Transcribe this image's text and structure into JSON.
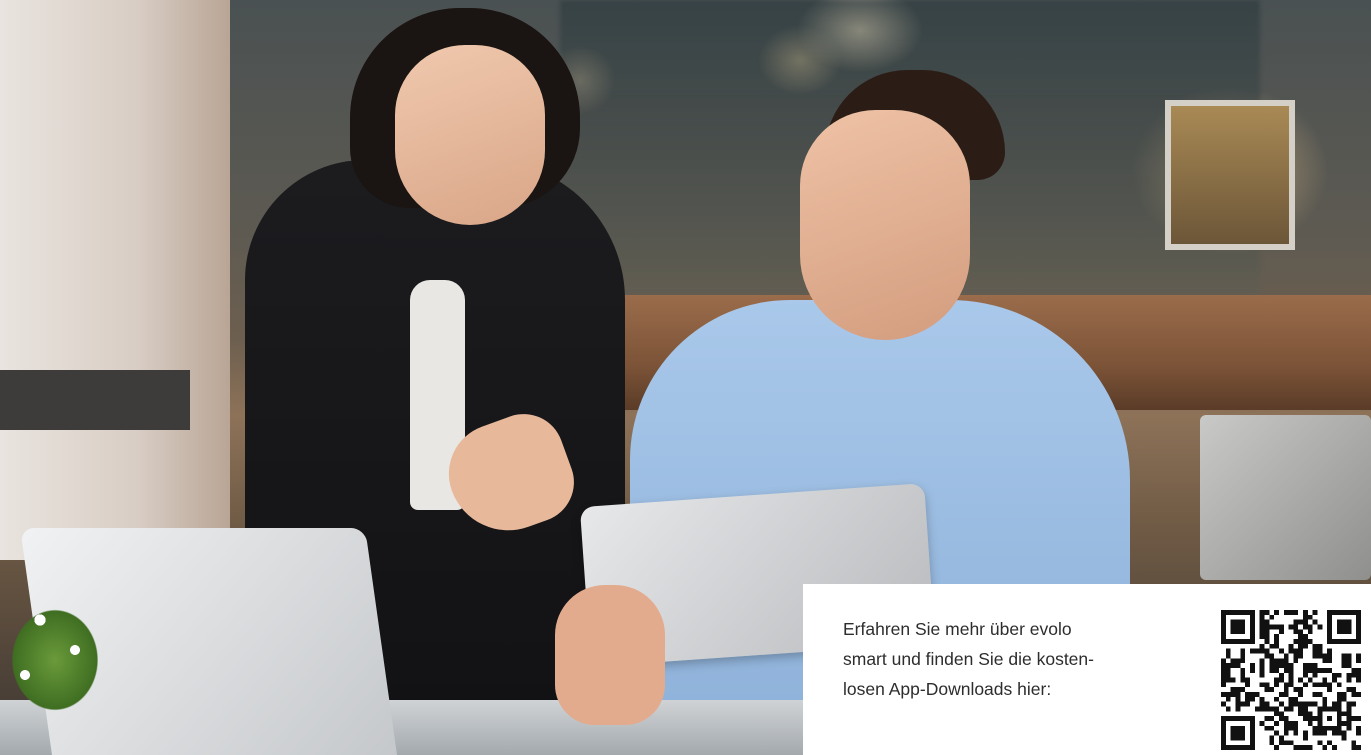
{
  "promo": {
    "text": "Erfahren Sie mehr über evolo\nsmart und finden Sie die kosten-\nlosen App-Downloads hier:",
    "qr_icon": "qr-code-icon"
  },
  "colors": {
    "text": "#2d2d2d",
    "panel": "#ffffff",
    "qr": "#111111"
  }
}
